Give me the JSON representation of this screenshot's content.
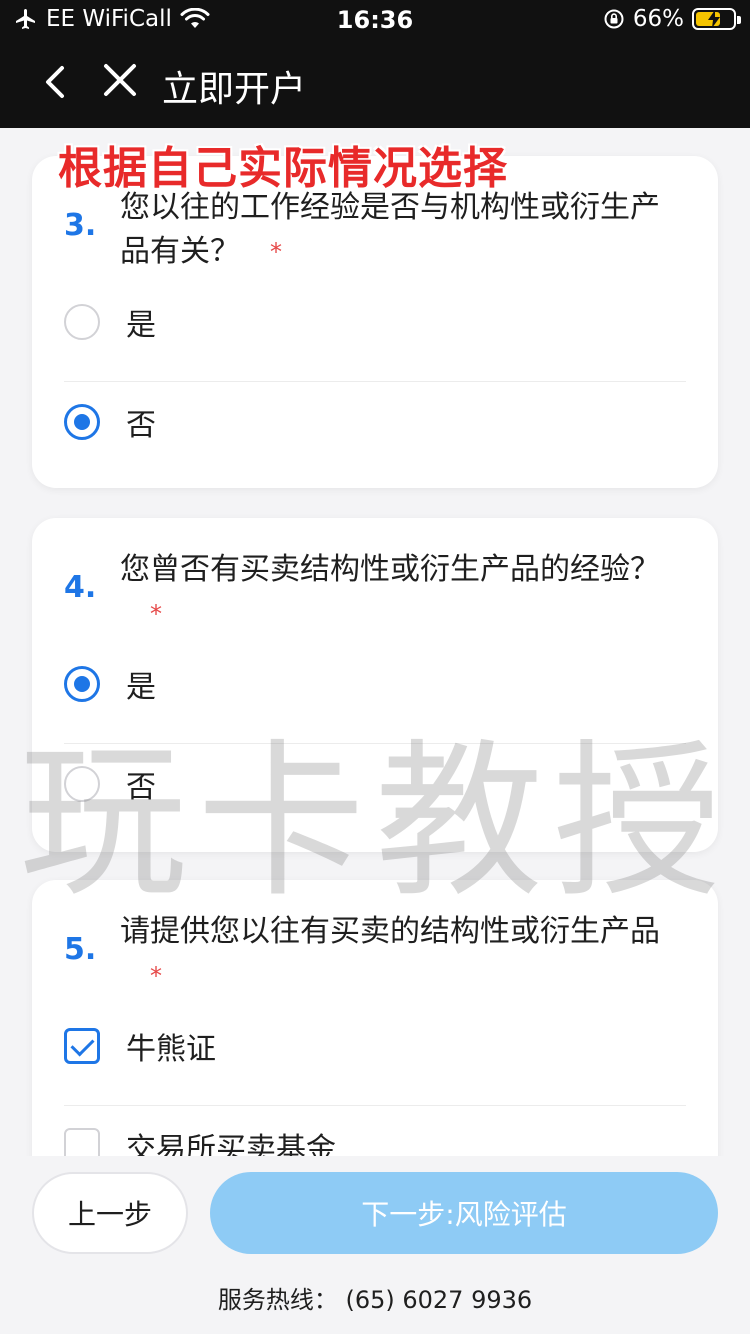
{
  "status_bar": {
    "carrier": "EE WiFiCall",
    "time": "16:36",
    "battery": "66%",
    "battery_level": 0.66,
    "icons": [
      "airplane-icon",
      "wifi-icon",
      "orientation-lock-icon",
      "battery-icon"
    ]
  },
  "header": {
    "title": "立即开户",
    "back_icon": "chevron-left-icon",
    "close_icon": "close-icon"
  },
  "overlay_note": "根据自己实际情况选择",
  "watermark": "玩卡教授",
  "questions": [
    {
      "number": "3.",
      "text": "您以往的工作经验是否与机构性或衍生产品有关？",
      "required": "*",
      "type": "radio",
      "options": [
        {
          "label": "是",
          "selected": false
        },
        {
          "label": "否",
          "selected": true
        }
      ]
    },
    {
      "number": "4.",
      "text": "您曾否有买卖结构性或衍生产品的经验？",
      "required": "*",
      "type": "radio",
      "options": [
        {
          "label": "是",
          "selected": true
        },
        {
          "label": "否",
          "selected": false
        }
      ]
    },
    {
      "number": "5.",
      "text": "请提供您以往有买卖的结构性或衍生产品",
      "required": "*",
      "type": "checkbox",
      "options": [
        {
          "label": "牛熊证",
          "selected": true
        },
        {
          "label": "交易所买卖基金",
          "selected": false
        }
      ]
    }
  ],
  "footer": {
    "prev_label": "上一步",
    "next_label": "下一步:风险评估",
    "hotline": "服务热线：  (65) 6027 9936"
  },
  "colors": {
    "accent": "#1e76e6",
    "next_button": "#8ecbf5",
    "required": "#e64848",
    "note": "#e82a2a",
    "header_bg": "#111111"
  }
}
